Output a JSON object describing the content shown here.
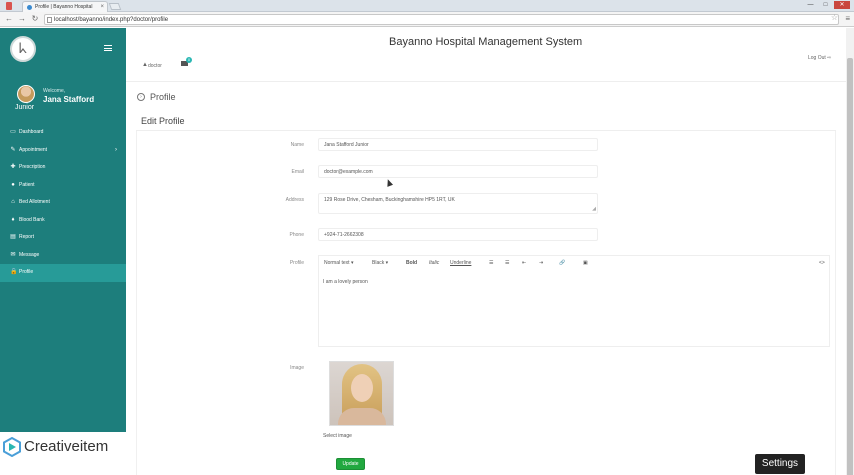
{
  "browser": {
    "tab_title": "Profile | Bayanno Hospital",
    "tab_close": "×",
    "url": "localhost/bayanno/index.php?doctor/profile",
    "back": "←",
    "forward": "→",
    "reload": "↻",
    "star": "☆",
    "menu": "≡",
    "minimize": "—",
    "maximize": "□",
    "close": "✕"
  },
  "sidebar": {
    "logo_glyph": "ᖾ",
    "welcome": "Welcome,",
    "user_name": "Jana Stafford",
    "user_role": "Junior",
    "items": [
      {
        "label": "Dashboard",
        "icon": "▭"
      },
      {
        "label": "Appointment",
        "icon": "✎",
        "chevron": "›"
      },
      {
        "label": "Prescription",
        "icon": "✚"
      },
      {
        "label": "Patient",
        "icon": "●"
      },
      {
        "label": "Bed Allotment",
        "icon": "⌂"
      },
      {
        "label": "Blood Bank",
        "icon": "♦"
      },
      {
        "label": "Report",
        "icon": "▤"
      },
      {
        "label": "Message",
        "icon": "✉"
      },
      {
        "label": "Profile",
        "icon": "🔒"
      }
    ],
    "active_index": 8
  },
  "header": {
    "system_title": "Bayanno Hospital Management System",
    "user_label": "doctor",
    "badge_count": "0",
    "logout": "Log Out"
  },
  "page": {
    "heading": "Profile",
    "panel_title": "Edit Profile"
  },
  "form": {
    "name_label": "Name",
    "name_value": "Jana Stafford Junior",
    "email_label": "Email",
    "email_value": "doctor@example.com",
    "address_label": "Address",
    "address_value": "129 Rose Drive, Chesham, Buckinghamshire HP5 1RT, UK",
    "phone_label": "Phone",
    "phone_value": "+924-71-2662308",
    "profile_label": "Profile",
    "editor_toolbar": {
      "normal_text": "Normal text ▾",
      "color": "Black ▾",
      "bold": "Bold",
      "italic": "Italic",
      "underline": "Underline",
      "ul_icon": "☰",
      "ol_icon": "☰",
      "outdent_icon": "⇤",
      "indent_icon": "⇥",
      "link_icon": "🔗",
      "image_icon": "▣",
      "html_icon": "<>"
    },
    "profile_text": "I am a lovely person",
    "image_label": "Image",
    "select_image": "Select image",
    "update_button": "Update"
  },
  "overlay": {
    "watermark_text": "Creativeitem",
    "settings_button": "Settings"
  }
}
